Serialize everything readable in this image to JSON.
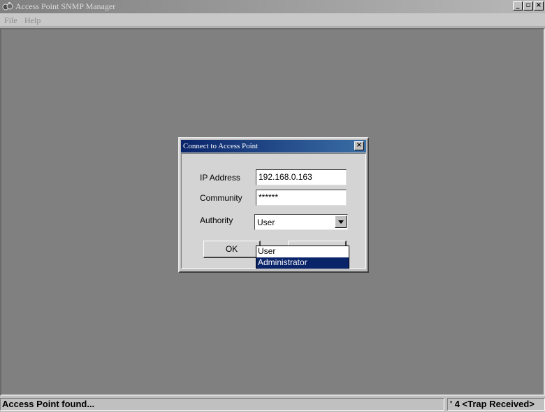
{
  "window": {
    "title": "Access Point SNMP Manager",
    "minimize_glyph": "_",
    "maximize_glyph": "▫",
    "close_glyph": "×"
  },
  "menu": {
    "items": [
      {
        "label": "File"
      },
      {
        "label": "Help"
      }
    ]
  },
  "dialog": {
    "title": "Connect to Access Point",
    "close_glyph": "×",
    "ip_label": "IP Address",
    "ip_value": "192.168.0.163",
    "community_label": "Community",
    "community_value": "******",
    "authority_label": "Authority",
    "authority_value": "User",
    "authority_options": [
      "User",
      "Administrator"
    ],
    "authority_highlighted": "Administrator",
    "ok_label": "OK"
  },
  "status": {
    "left": "Access Point found...",
    "right": "' 4 <Trap Received>"
  },
  "colors": {
    "desktop": "#808080",
    "title_active": "#0a246a",
    "selection": "#0a246a"
  },
  "icons": {
    "app": "app-icon",
    "dialog_close": "close-icon",
    "dropdown": "chevron-down-icon"
  }
}
